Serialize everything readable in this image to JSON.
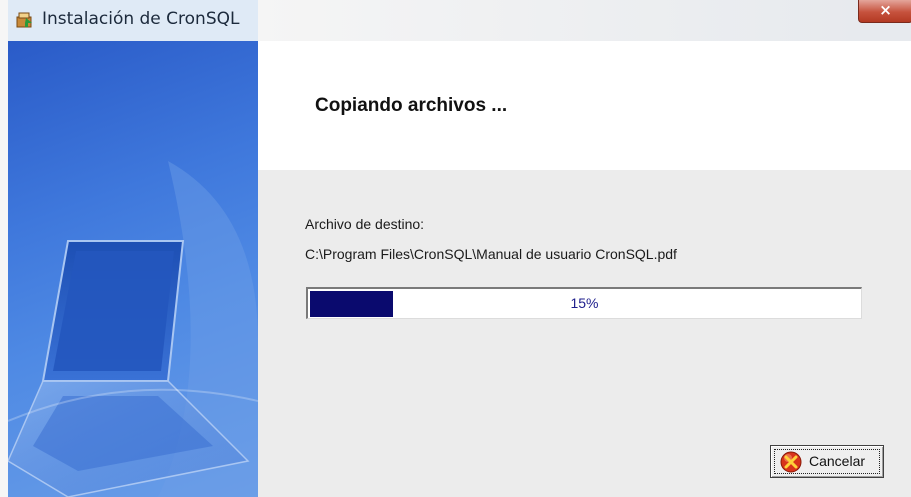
{
  "window": {
    "title": "Instalación de CronSQL",
    "close_glyph": "×"
  },
  "header": {
    "title": "Copiando archivos ..."
  },
  "content": {
    "destination_label": "Archivo de destino:",
    "destination_path": "C:\\Program Files\\CronSQL\\Manual de usuario CronSQL.pdf",
    "progress_value": 15,
    "progress_text": "15%"
  },
  "buttons": {
    "cancel_label": "Cancelar"
  },
  "icons": {
    "title_icon": "installer-icon",
    "cancel_icon": "cancel-x-icon",
    "banner_image": "laptop-illustration"
  },
  "colors": {
    "progress_fill": "#0a0a6e",
    "progress_text": "#1d1d8c",
    "banner_blue": "#3f78dc"
  }
}
